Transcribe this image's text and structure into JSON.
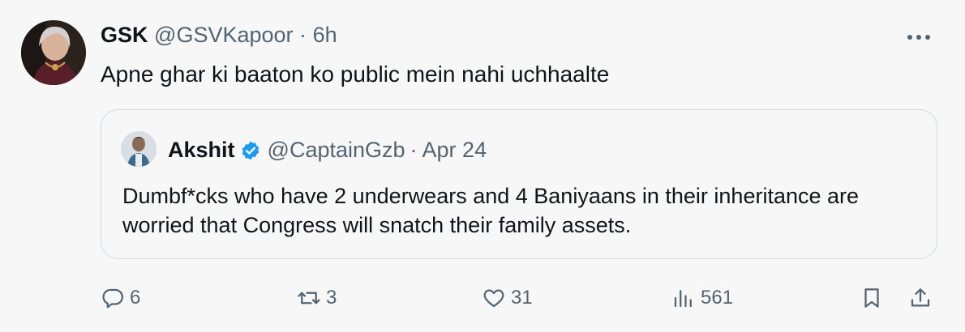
{
  "tweet": {
    "display_name": "GSK",
    "handle": "@GSVKapoor",
    "separator": "·",
    "time": "6h",
    "text": "Apne ghar ki baaton ko public mein nahi uchhaalte",
    "more_icon": "more-icon"
  },
  "quoted": {
    "display_name": "Akshit",
    "handle": "@CaptainGzb",
    "separator": "·",
    "time": "Apr 24",
    "verified": true,
    "verified_color": "#1d9bf0",
    "text": "Dumbf*cks who have 2 underwears and 4 Baniyaans in their inheritance are worried that Congress will snatch their family assets."
  },
  "actions": {
    "replies": "6",
    "reposts": "3",
    "likes": "31",
    "views": "561"
  },
  "colors": {
    "background": "#f7f7f7",
    "text": "#0f1419",
    "muted": "#536471",
    "border": "#cfd9de"
  }
}
